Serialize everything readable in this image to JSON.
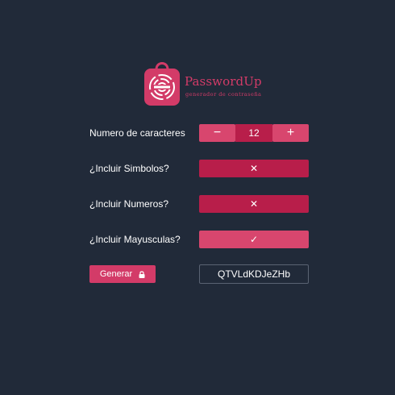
{
  "brand": {
    "name": "PasswordUp",
    "tagline": "generador de contraseña",
    "color": "#d33b68"
  },
  "length": {
    "label": "Numero de caracteres",
    "value": "12",
    "decrement_symbol": "−",
    "increment_symbol": "+"
  },
  "options": [
    {
      "label": "¿Incluir Simbolos?",
      "checked": false,
      "symbol": "✕"
    },
    {
      "label": "¿Incluir Numeros?",
      "checked": false,
      "symbol": "✕"
    },
    {
      "label": "¿Incluir Mayusculas?",
      "checked": true,
      "symbol": "✓"
    }
  ],
  "generate_button": {
    "label": "Generar",
    "icon": "lock-icon"
  },
  "result": {
    "password": "QTVLdKDJeZHb"
  },
  "colors": {
    "background": "#212a39",
    "accent": "#d8466e",
    "accent_dark": "#b81e4a"
  }
}
